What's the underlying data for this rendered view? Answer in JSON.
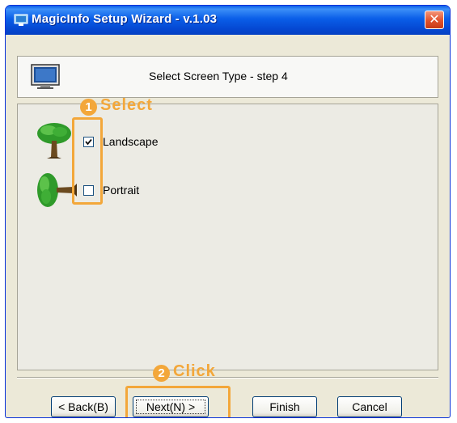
{
  "window": {
    "title": "MagicInfo Setup Wizard - v.1.03",
    "close_glyph": "✕"
  },
  "header": {
    "title": "Select Screen Type - step 4",
    "icon": "monitor-icon"
  },
  "options": [
    {
      "label": "Landscape",
      "checked": true,
      "icon": "tree-upright-icon"
    },
    {
      "label": "Portrait",
      "checked": false,
      "icon": "tree-sideways-icon"
    }
  ],
  "annotations": {
    "select": {
      "number": "1",
      "text": "Select"
    },
    "click": {
      "number": "2",
      "text": "Click"
    },
    "color": "#f3a73a"
  },
  "buttons": {
    "back": "< Back(B)",
    "next": "Next(N) >",
    "finish": "Finish",
    "cancel": "Cancel"
  },
  "colors": {
    "titlebar": "#0a5ee8",
    "dialog_bg": "#ece9d8"
  }
}
